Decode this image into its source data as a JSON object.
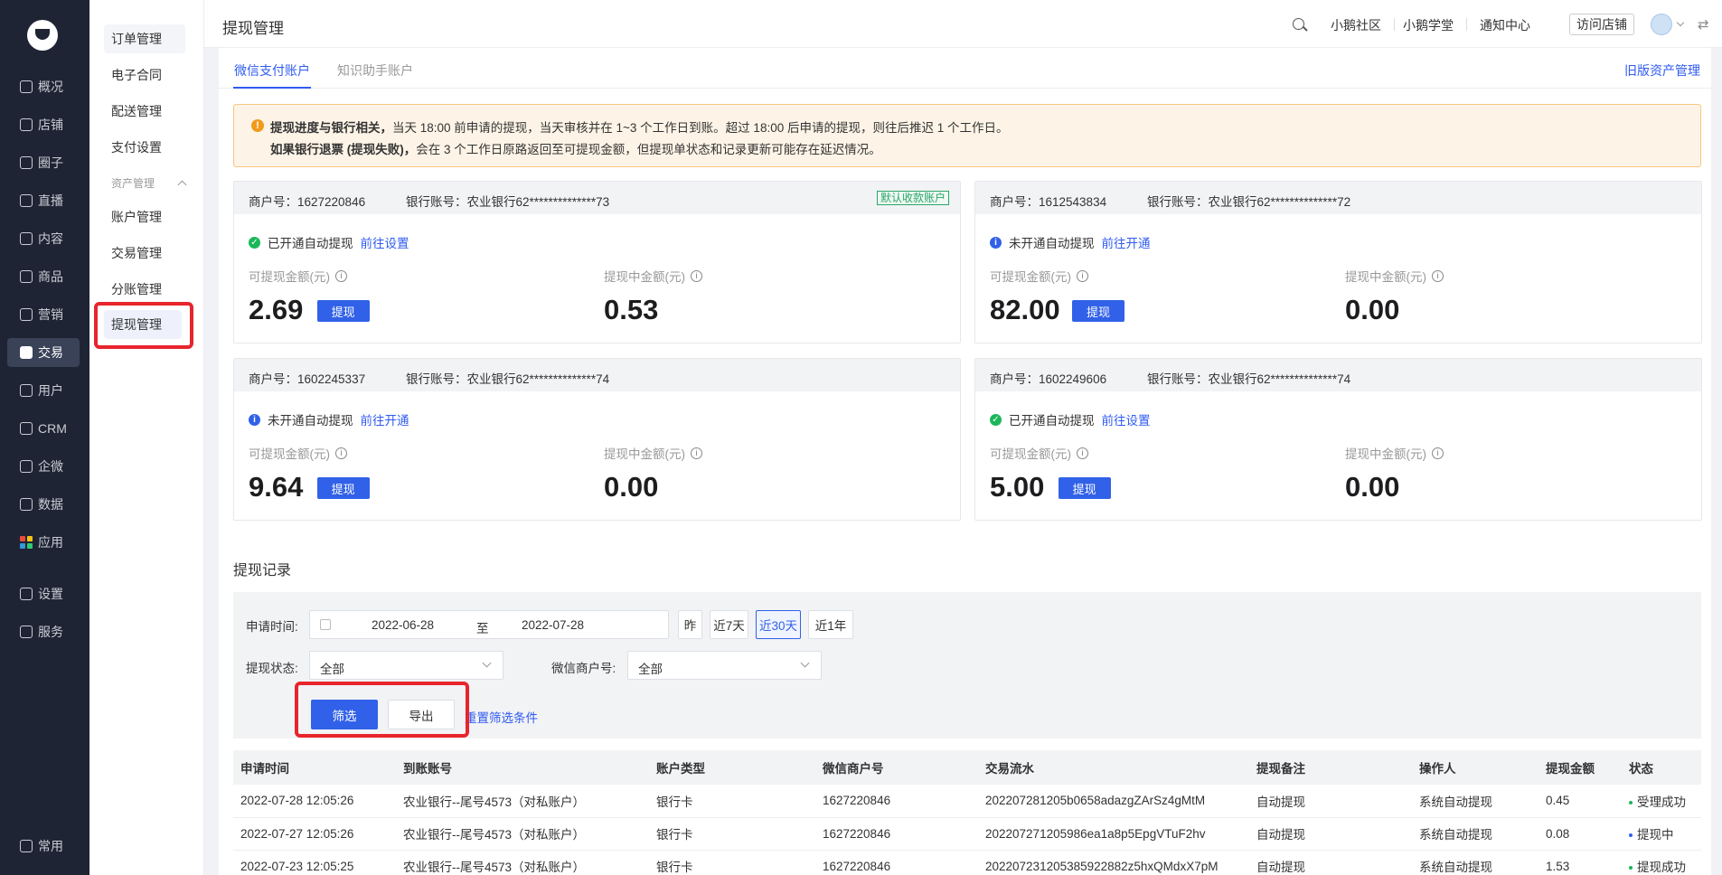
{
  "nav": {
    "items": [
      {
        "label": "概况",
        "icon": "dashboard-icon"
      },
      {
        "label": "店铺",
        "icon": "store-icon"
      },
      {
        "label": "圈子",
        "icon": "community-icon"
      },
      {
        "label": "直播",
        "icon": "live-icon"
      },
      {
        "label": "内容",
        "icon": "content-icon"
      },
      {
        "label": "商品",
        "icon": "product-icon"
      },
      {
        "label": "营销",
        "icon": "marketing-icon"
      },
      {
        "label": "交易",
        "icon": "trade-icon"
      },
      {
        "label": "用户",
        "icon": "user-icon"
      },
      {
        "label": "CRM",
        "icon": "crm-icon"
      },
      {
        "label": "企微",
        "icon": "wecom-icon"
      },
      {
        "label": "数据",
        "icon": "data-icon"
      },
      {
        "label": "应用",
        "icon": "apps-icon"
      },
      {
        "label": "设置",
        "icon": "settings-icon"
      },
      {
        "label": "服务",
        "icon": "service-icon"
      },
      {
        "label": "常用",
        "icon": "menu-icon"
      }
    ]
  },
  "subnav": {
    "items": [
      "订单管理",
      "电子合同",
      "配送管理",
      "支付设置"
    ],
    "group_label": "资产管理",
    "group_items": [
      "账户管理",
      "交易管理",
      "分账管理",
      "提现管理"
    ]
  },
  "header": {
    "title": "提现管理",
    "links": [
      "小鹅社区",
      "小鹅学堂",
      "通知中心"
    ],
    "visit_store": "访问店铺"
  },
  "tabs": [
    "微信支付账户",
    "知识助手账户"
  ],
  "legacy_link": "旧版资产管理",
  "notice": {
    "line1_bold": "提现进度与银行相关，",
    "line1_rest": "当天 18:00 前申请的提现，当天审核并在 1~3 个工作日到账。超过 18:00 后申请的提现，则往后推迟 1 个工作日。",
    "line2_bold": "如果银行退票 (提现失败)，",
    "line2_rest": "会在 3 个工作日原路返回至可提现金额，但提现单状态和记录更新可能存在延迟情况。"
  },
  "accounts": [
    {
      "merchant": "商户号：1627220846",
      "bank": "银行账号：农业银行62**************73",
      "tag": "默认收款账户",
      "status": "已开通自动提现",
      "status_on": true,
      "action": "前往设置",
      "avail_label": "可提现金额(元)",
      "avail": "2.69",
      "pending_label": "提现中金额(元)",
      "pending": "0.53",
      "btn": "提现"
    },
    {
      "merchant": "商户号：1612543834",
      "bank": "银行账号：农业银行62**************72",
      "tag": "",
      "status": "未开通自动提现",
      "status_on": false,
      "action": "前往开通",
      "avail_label": "可提现金额(元)",
      "avail": "82.00",
      "pending_label": "提现中金额(元)",
      "pending": "0.00",
      "btn": "提现"
    },
    {
      "merchant": "商户号：1602245337",
      "bank": "银行账号：农业银行62**************74",
      "tag": "",
      "status": "未开通自动提现",
      "status_on": false,
      "action": "前往开通",
      "avail_label": "可提现金额(元)",
      "avail": "9.64",
      "pending_label": "提现中金额(元)",
      "pending": "0.00",
      "btn": "提现"
    },
    {
      "merchant": "商户号：1602249606",
      "bank": "银行账号：农业银行62**************74",
      "tag": "",
      "status": "已开通自动提现",
      "status_on": true,
      "action": "前往设置",
      "avail_label": "可提现金额(元)",
      "avail": "5.00",
      "pending_label": "提现中金额(元)",
      "pending": "0.00",
      "btn": "提现"
    }
  ],
  "records_title": "提现记录",
  "filter": {
    "date_label": "申请时间:",
    "date_from": "2022-06-28",
    "date_sep": "至",
    "date_to": "2022-07-28",
    "quick": [
      "昨",
      "近7天",
      "近30天",
      "近1年"
    ],
    "quick_active": "近30天",
    "status_label": "提现状态:",
    "status_value": "全部",
    "merchant_label": "微信商户号:",
    "merchant_value": "全部",
    "filter_btn": "筛选",
    "export_btn": "导出",
    "reset_link": "重置筛选条件"
  },
  "table": {
    "columns": [
      "申请时间",
      "到账账号",
      "账户类型",
      "微信商户号",
      "交易流水",
      "提现备注",
      "操作人",
      "提现金额",
      "状态"
    ],
    "rows": [
      {
        "time": "2022-07-28 12:05:26",
        "account": "农业银行--尾号4573（对私账户）",
        "type": "银行卡",
        "merchant": "1627220846",
        "serial": "202207281205b0658adazgZArSz4gMtM",
        "remark": "自动提现",
        "operator": "系统自动提现",
        "amount": "0.45",
        "status": "受理成功",
        "status_color": "#1ab75a"
      },
      {
        "time": "2022-07-27 12:05:26",
        "account": "农业银行--尾号4573（对私账户）",
        "type": "银行卡",
        "merchant": "1627220846",
        "serial": "202207271205986ea1a8p5EpgVTuF2hv",
        "remark": "自动提现",
        "operator": "系统自动提现",
        "amount": "0.08",
        "status": "提现中",
        "status_color": "#3161e8"
      },
      {
        "time": "2022-07-23 12:05:25",
        "account": "农业银行--尾号4573（对私账户）",
        "type": "银行卡",
        "merchant": "1627220846",
        "serial": "202207231205385922882z5hxQMdxX7pM",
        "remark": "自动提现",
        "operator": "系统自动提现",
        "amount": "1.53",
        "status": "提现成功",
        "status_color": "#1ab75a"
      }
    ]
  }
}
